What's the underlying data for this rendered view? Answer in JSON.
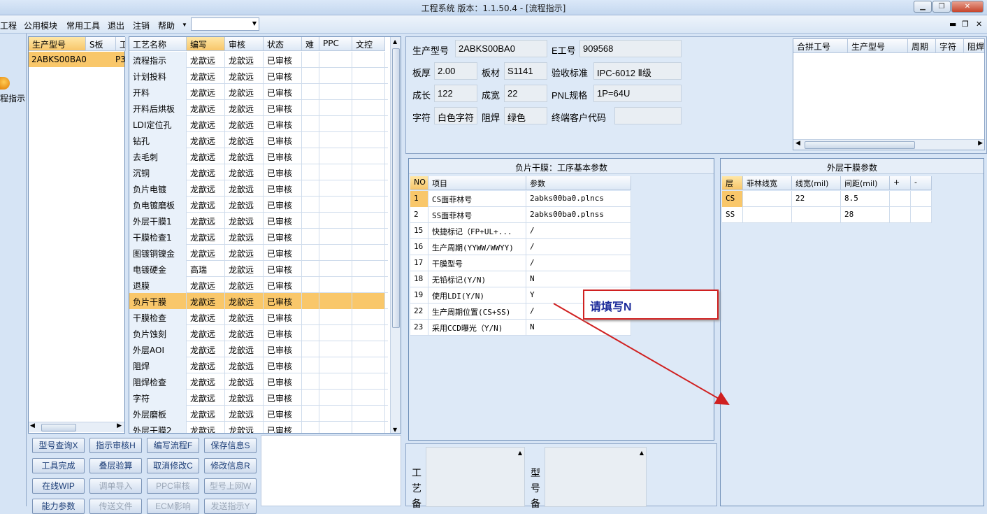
{
  "window": {
    "title": "工程系统   版本：1.1.50.4 - [流程指示]"
  },
  "menu": {
    "items": [
      "工程",
      "公用模块",
      "常用工具",
      "退出",
      "注销",
      "帮助"
    ],
    "combo_value": ""
  },
  "left_strip": {
    "label": "程指示"
  },
  "product_list": {
    "headers": [
      "生产型号",
      "S板",
      "工"
    ],
    "rows": [
      [
        "2ABKS00BA0",
        "",
        "P3"
      ]
    ]
  },
  "process_grid": {
    "headers": [
      "工艺名称",
      "编写",
      "审核",
      "状态",
      "难",
      "PPC",
      "文控"
    ],
    "rows": [
      [
        "流程指示",
        "龙歆远",
        "龙歆远",
        "已审核"
      ],
      [
        "计划投料",
        "龙歆远",
        "龙歆远",
        "已审核"
      ],
      [
        "开料",
        "龙歆远",
        "龙歆远",
        "已审核"
      ],
      [
        "开料后烘板",
        "龙歆远",
        "龙歆远",
        "已审核"
      ],
      [
        "LDI定位孔",
        "龙歆远",
        "龙歆远",
        "已审核"
      ],
      [
        "钻孔",
        "龙歆远",
        "龙歆远",
        "已审核"
      ],
      [
        "去毛刺",
        "龙歆远",
        "龙歆远",
        "已审核"
      ],
      [
        "沉铜",
        "龙歆远",
        "龙歆远",
        "已审核"
      ],
      [
        "负片电镀",
        "龙歆远",
        "龙歆远",
        "已审核"
      ],
      [
        "负电镀磨板",
        "龙歆远",
        "龙歆远",
        "已审核"
      ],
      [
        "外层干膜1",
        "龙歆远",
        "龙歆远",
        "已审核"
      ],
      [
        "干膜检查1",
        "龙歆远",
        "龙歆远",
        "已审核"
      ],
      [
        "图镀铜镍金",
        "龙歆远",
        "龙歆远",
        "已审核"
      ],
      [
        "电镀硬金",
        "高瑞",
        "龙歆远",
        "已审核"
      ],
      [
        "退膜",
        "龙歆远",
        "龙歆远",
        "已审核"
      ],
      [
        "负片干膜",
        "龙歆远",
        "龙歆远",
        "已审核"
      ],
      [
        "干膜检查",
        "龙歆远",
        "龙歆远",
        "已审核"
      ],
      [
        "负片蚀刻",
        "龙歆远",
        "龙歆远",
        "已审核"
      ],
      [
        "外层AOI",
        "龙歆远",
        "龙歆远",
        "已审核"
      ],
      [
        "阻焊",
        "龙歆远",
        "龙歆远",
        "已审核"
      ],
      [
        "阻焊检查",
        "龙歆远",
        "龙歆远",
        "已审核"
      ],
      [
        "字符",
        "龙歆远",
        "龙歆远",
        "已审核"
      ],
      [
        "外层磨板",
        "龙歆远",
        "龙歆远",
        "已审核"
      ],
      [
        "外层干膜2",
        "龙歆远",
        "龙歆远",
        "已审核"
      ]
    ],
    "selected_index": 15
  },
  "buttons": [
    {
      "label": "型号查询X",
      "enabled": true
    },
    {
      "label": "指示审核H",
      "enabled": true
    },
    {
      "label": "编写流程F",
      "enabled": true
    },
    {
      "label": "保存信息S",
      "enabled": true
    },
    {
      "label": "工具完成",
      "enabled": true
    },
    {
      "label": "叠层验算",
      "enabled": true
    },
    {
      "label": "取消修改C",
      "enabled": true
    },
    {
      "label": "修改信息R",
      "enabled": true
    },
    {
      "label": "在线WIP",
      "enabled": true
    },
    {
      "label": "调单导入",
      "enabled": false
    },
    {
      "label": "PPC审核",
      "enabled": false
    },
    {
      "label": "型号上网W",
      "enabled": false
    },
    {
      "label": "能力参数",
      "enabled": true
    },
    {
      "label": "传送文件",
      "enabled": false
    },
    {
      "label": "ECM影响",
      "enabled": false
    },
    {
      "label": "发送指示Y",
      "enabled": false
    }
  ],
  "info": {
    "product_model_label": "生产型号",
    "product_model": "2ABKS00BA0",
    "e_worker_label": "E工号",
    "e_worker": "909568",
    "thickness_label": "板厚",
    "thickness": "2.00",
    "material_label": "板材",
    "material": "S1141",
    "standard_label": "验收标准",
    "standard": "IPC-6012 Ⅱ级",
    "length_label": "成长",
    "length": "122",
    "width_label": "成宽",
    "width": "22",
    "pnl_label": "PNL规格",
    "pnl": "1P=64U",
    "char_label": "字符",
    "char": "白色字符",
    "mask_label": "阻焊",
    "mask": "绿色",
    "customer_label": "终端客户代码",
    "customer": ""
  },
  "merge_grid": {
    "headers": [
      "合拼工号",
      "生产型号",
      "周期",
      "字符",
      "阻焊"
    ]
  },
  "param_section": {
    "title": "负片干膜：工序基本参数",
    "headers": [
      "NO",
      "项目",
      "参数"
    ],
    "rows": [
      [
        "1",
        "CS面菲林号",
        "2abks00ba0.plncs"
      ],
      [
        "2",
        "SS面菲林号",
        "2abks00ba0.plnss"
      ],
      [
        "15",
        "快捷标记（FP+UL+...",
        "/"
      ],
      [
        "16",
        "生产周期(YYWW/WWYY)",
        "/"
      ],
      [
        "17",
        "干膜型号",
        "/"
      ],
      [
        "18",
        "无铅标记(Y/N)",
        "N"
      ],
      [
        "19",
        "使用LDI(Y/N)",
        "Y"
      ],
      [
        "22",
        "生产周期位置(CS+SS)",
        "/"
      ],
      [
        "23",
        "采用CCD曝光（Y/N)",
        "N"
      ]
    ]
  },
  "outer_section": {
    "title": "外层干膜参数",
    "headers": [
      "层",
      "菲林线宽",
      "线宽(mil)",
      "间距(mil)",
      "+",
      "-"
    ],
    "rows": [
      [
        "CS",
        "",
        "22",
        "8.5",
        "",
        ""
      ],
      [
        "SS",
        "",
        "",
        "28",
        "",
        ""
      ]
    ]
  },
  "notes": {
    "process_label": "工艺备",
    "model_label": "型号备"
  },
  "annotation": {
    "text": "请填写N",
    "color": "#d02020"
  }
}
